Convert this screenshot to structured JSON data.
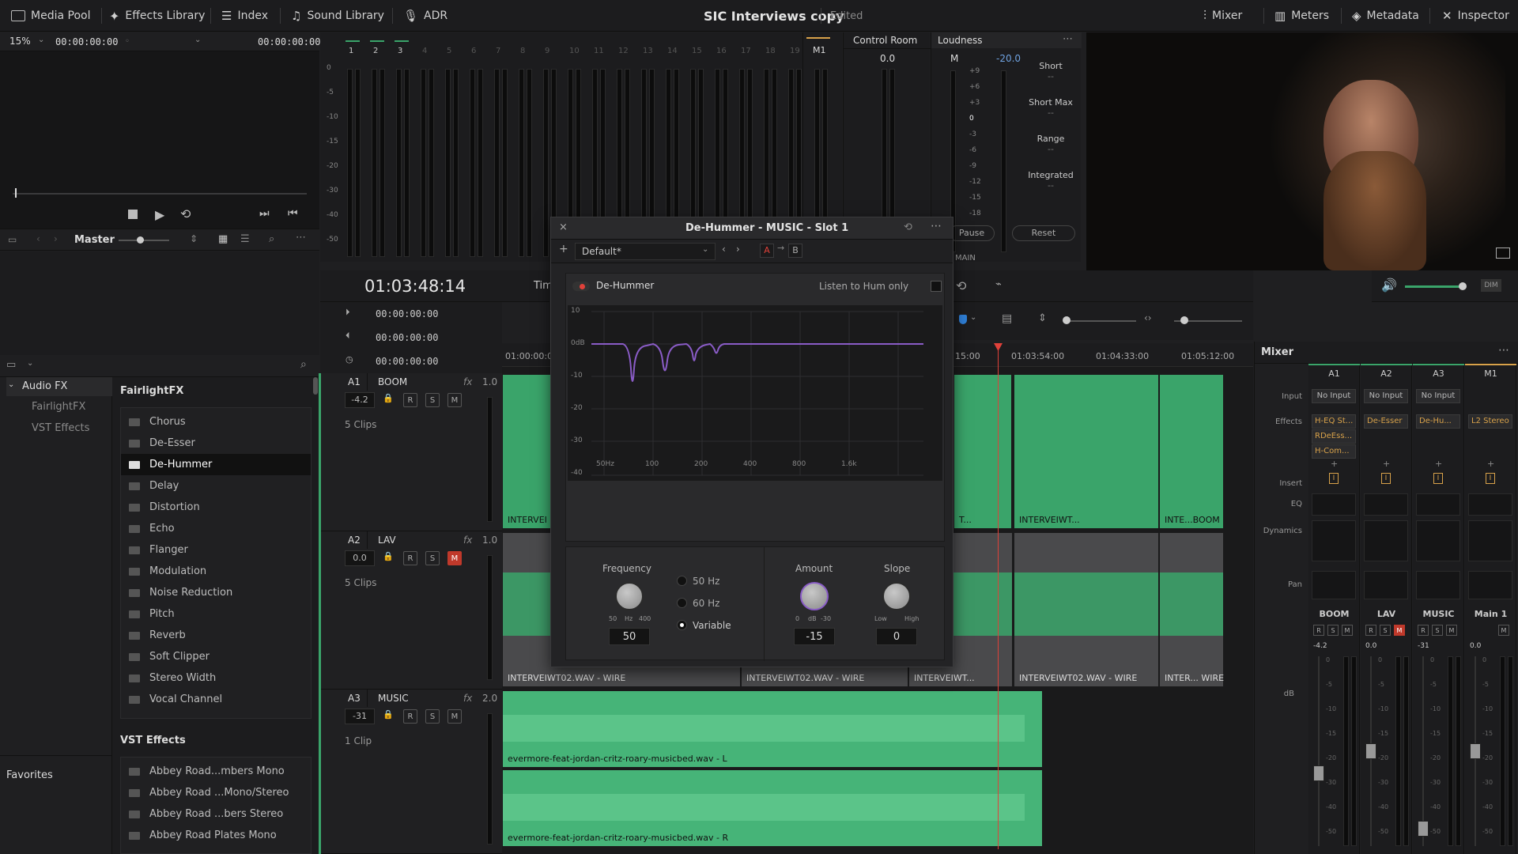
{
  "topbar": {
    "media_pool": "Media Pool",
    "effects_library": "Effects Library",
    "index": "Index",
    "sound_library": "Sound Library",
    "adr": "ADR",
    "project_title": "SIC Interviews copy",
    "project_status": "Edited",
    "mixer": "Mixer",
    "meters": "Meters",
    "metadata": "Metadata",
    "inspector": "Inspector"
  },
  "viewer": {
    "zoom": "15%",
    "timecode_in": "00:00:00:00",
    "timecode_out": "00:00:00:00",
    "master_label": "Master"
  },
  "meters": {
    "channel_numbers": [
      "1",
      "2",
      "3",
      "4",
      "5",
      "6",
      "7",
      "8",
      "9",
      "10",
      "11",
      "12",
      "13",
      "14",
      "15",
      "16",
      "17",
      "18",
      "19"
    ],
    "scale": [
      "0",
      "-5",
      "-10",
      "-15",
      "-20",
      "-30",
      "-40",
      "-50"
    ],
    "m1_label": "M1",
    "control_room_label": "Control Room",
    "control_room_value": "0.0",
    "loudness_label": "Loudness",
    "loudness_m": "M",
    "loudness_value": "-20.0",
    "loudness_scale": [
      "+9",
      "+6",
      "+3",
      "0",
      "-3",
      "-6",
      "-9",
      "-12",
      "-15",
      "-18"
    ],
    "short": "Short",
    "short_max": "Short Max",
    "range": "Range",
    "integrated": "Integrated",
    "dash": "--",
    "pause": "Pause",
    "reset": "Reset",
    "main": "MAIN"
  },
  "timeline": {
    "timecode": "01:03:48:14",
    "tc_row1": "00:00:00:00",
    "tc_row2": "00:00:00:00",
    "tc_row3": "00:00:00:00",
    "tim_label": "Tim",
    "ruler": [
      "01:00:00:00",
      "15:00",
      "01:03:54:00",
      "01:04:33:00",
      "01:05:12:00"
    ]
  },
  "tracks": [
    {
      "id": "A1",
      "name": "BOOM",
      "fx": "fx",
      "ch": "1.0",
      "vol": "-4.2",
      "clips": "5 Clips"
    },
    {
      "id": "A2",
      "name": "LAV",
      "fx": "fx",
      "ch": "1.0",
      "vol": "0.0",
      "clips": "5 Clips"
    },
    {
      "id": "A3",
      "name": "MUSIC",
      "fx": "fx",
      "ch": "2.0",
      "vol": "-31",
      "clips": "1 Clip"
    }
  ],
  "clips": {
    "a1_first": "INTERVEI",
    "a1_c2": "T...",
    "a1_c3": "INTERVEIWT...",
    "a1_c4": "INTE...BOOM",
    "a2_c1": "INTERVEIWT02.WAV - WIRE",
    "a2_c2": "INTERVEIWT02.WAV - WIRE",
    "a2_c3": "INTERVEIWT...",
    "a2_c4": "INTERVEIWT02.WAV - WIRE",
    "a2_c5": "INTER... WIRE",
    "a3_l": "evermore-feat-jordan-critz-roary-musicbed.wav - L",
    "a3_r": "evermore-feat-jordan-critz-roary-musicbed.wav - R"
  },
  "letters": {
    "r": "R",
    "s": "S",
    "m": "M"
  },
  "effects_library": {
    "tree": {
      "audio_fx": "Audio FX",
      "fairlight_fx": "FairlightFX",
      "vst_effects": "VST Effects",
      "favorites": "Favorites"
    },
    "section_fairlight": "FairlightFX",
    "fairlight_items": [
      "Chorus",
      "De-Esser",
      "De-Hummer",
      "Delay",
      "Distortion",
      "Echo",
      "Flanger",
      "Modulation",
      "Noise Reduction",
      "Pitch",
      "Reverb",
      "Soft Clipper",
      "Stereo Width",
      "Vocal Channel"
    ],
    "selected_index": 2,
    "section_vst": "VST Effects",
    "vst_items": [
      "Abbey Road...mbers Mono",
      "Abbey Road ...Mono/Stereo",
      "Abbey Road ...bers Stereo",
      "Abbey Road Plates Mono"
    ]
  },
  "plugin": {
    "title": "De-Hummer - MUSIC - Slot 1",
    "preset": "Default*",
    "a_label": "A",
    "b_label": "B",
    "enable_label": "De-Hummer",
    "listen_label": "Listen to Hum only",
    "graph_y": [
      "10",
      "0dB",
      "-10",
      "-20",
      "-30",
      "-40"
    ],
    "graph_x": [
      "50Hz",
      "100",
      "200",
      "400",
      "800",
      "1.6k"
    ],
    "frequency_label": "Frequency",
    "freq_min": "50",
    "freq_unit": "Hz",
    "freq_max": "400",
    "frequency_value": "50",
    "opt_50": "50 Hz",
    "opt_60": "60 Hz",
    "opt_variable": "Variable",
    "amount_label": "Amount",
    "amount_min": "0",
    "amount_unit": "dB",
    "amount_max": "-30",
    "amount_value": "-15",
    "slope_label": "Slope",
    "slope_low": "Low",
    "slope_high": "High",
    "slope_value": "0"
  },
  "mixer": {
    "title": "Mixer",
    "channels": [
      "A1",
      "A2",
      "A3",
      "M1"
    ],
    "row_input": "Input",
    "row_effects": "Effects",
    "row_insert": "Insert",
    "row_eq": "EQ",
    "row_dynamics": "Dynamics",
    "row_pan": "Pan",
    "inputs": [
      "No Input",
      "No Input",
      "No Input",
      ""
    ],
    "effects": [
      [
        "H-EQ St...",
        "RDeEss...",
        "H-Com..."
      ],
      [
        "De-Esser"
      ],
      [
        "De-Hu..."
      ],
      [
        "L2 Stereo"
      ]
    ],
    "names": [
      "BOOM",
      "LAV",
      "MUSIC",
      "Main 1"
    ],
    "levels": [
      "-4.2",
      "0.0",
      "-31",
      "0.0"
    ],
    "db_label": "dB",
    "fader_scale": [
      "0",
      "-5",
      "-10",
      "-15",
      "-20",
      "-30",
      "-40",
      "-50"
    ]
  },
  "colors": {
    "accent_green": "#3aa46a",
    "playhead_red": "#e0413a",
    "plugin_purple": "#8a5cc7",
    "fx_orange": "#d8a24a"
  }
}
